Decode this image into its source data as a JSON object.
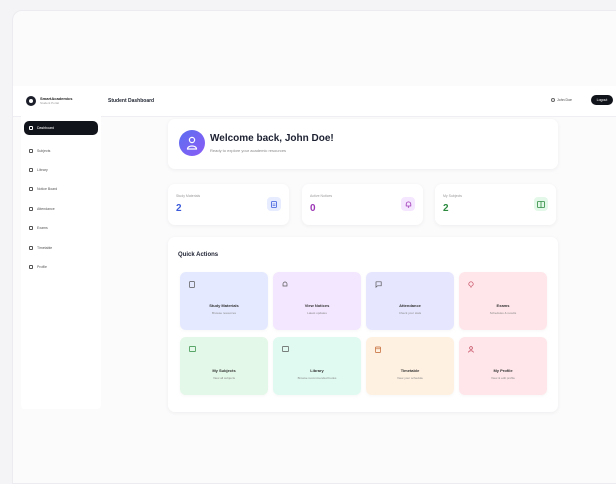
{
  "header": {
    "brand_name": "SmartAcademics",
    "brand_sub": "Student Portal",
    "page_title": "Student Dashboard",
    "user_label": "John Doe",
    "logout_label": "Logout"
  },
  "sidebar": {
    "items": [
      {
        "label": "Dashboard",
        "icon": "grid-icon",
        "active": true
      },
      {
        "label": "Subjects",
        "icon": "book-icon",
        "active": false
      },
      {
        "label": "Library",
        "icon": "library-icon",
        "active": false
      },
      {
        "label": "Notice Board",
        "icon": "bell-icon",
        "active": false
      },
      {
        "label": "Attendance",
        "icon": "calendar-icon",
        "active": false
      },
      {
        "label": "Exams",
        "icon": "clipboard-icon",
        "active": false
      },
      {
        "label": "Timetable",
        "icon": "clock-icon",
        "active": false
      },
      {
        "label": "Profile",
        "icon": "user-icon",
        "active": false
      }
    ]
  },
  "welcome": {
    "title": "Welcome back, John Doe!",
    "subtitle": "Ready to explore your academic resources"
  },
  "stats": [
    {
      "label": "Study Materials",
      "value": "2",
      "icon": "document-icon",
      "color": "#3b5bdb",
      "bg": "#e7ecff"
    },
    {
      "label": "Active Notices",
      "value": "0",
      "icon": "bell-icon",
      "color": "#9c36b5",
      "bg": "#f5e6ff"
    },
    {
      "label": "My Subjects",
      "value": "2",
      "icon": "book-icon",
      "color": "#2b8a3e",
      "bg": "#e3f8e8"
    }
  ],
  "quick_actions": {
    "title": "Quick Actions",
    "tiles": [
      {
        "title": "Study Materials",
        "sub": "Browse resources",
        "icon": "document-icon",
        "bg": "#e4e9ff"
      },
      {
        "title": "View Notices",
        "sub": "Latest updates",
        "icon": "bell-icon",
        "bg": "#f3e6ff"
      },
      {
        "title": "Attendance",
        "sub": "Check your stats",
        "icon": "chat-icon",
        "bg": "#e6e6ff"
      },
      {
        "title": "Exams",
        "sub": "Schedules & results",
        "icon": "pin-icon",
        "bg": "#ffe6ea"
      },
      {
        "title": "My Subjects",
        "sub": "View all subjects",
        "icon": "book-icon",
        "bg": "#e3f8e8"
      },
      {
        "title": "Library",
        "sub": "Browse recommended books",
        "icon": "library-icon",
        "bg": "#e0faf1"
      },
      {
        "title": "Timetable",
        "sub": "View your schedule",
        "icon": "calendar-icon",
        "bg": "#fff1e2"
      },
      {
        "title": "My Profile",
        "sub": "View & edit profile",
        "icon": "user-icon",
        "bg": "#ffe6ea"
      }
    ]
  }
}
